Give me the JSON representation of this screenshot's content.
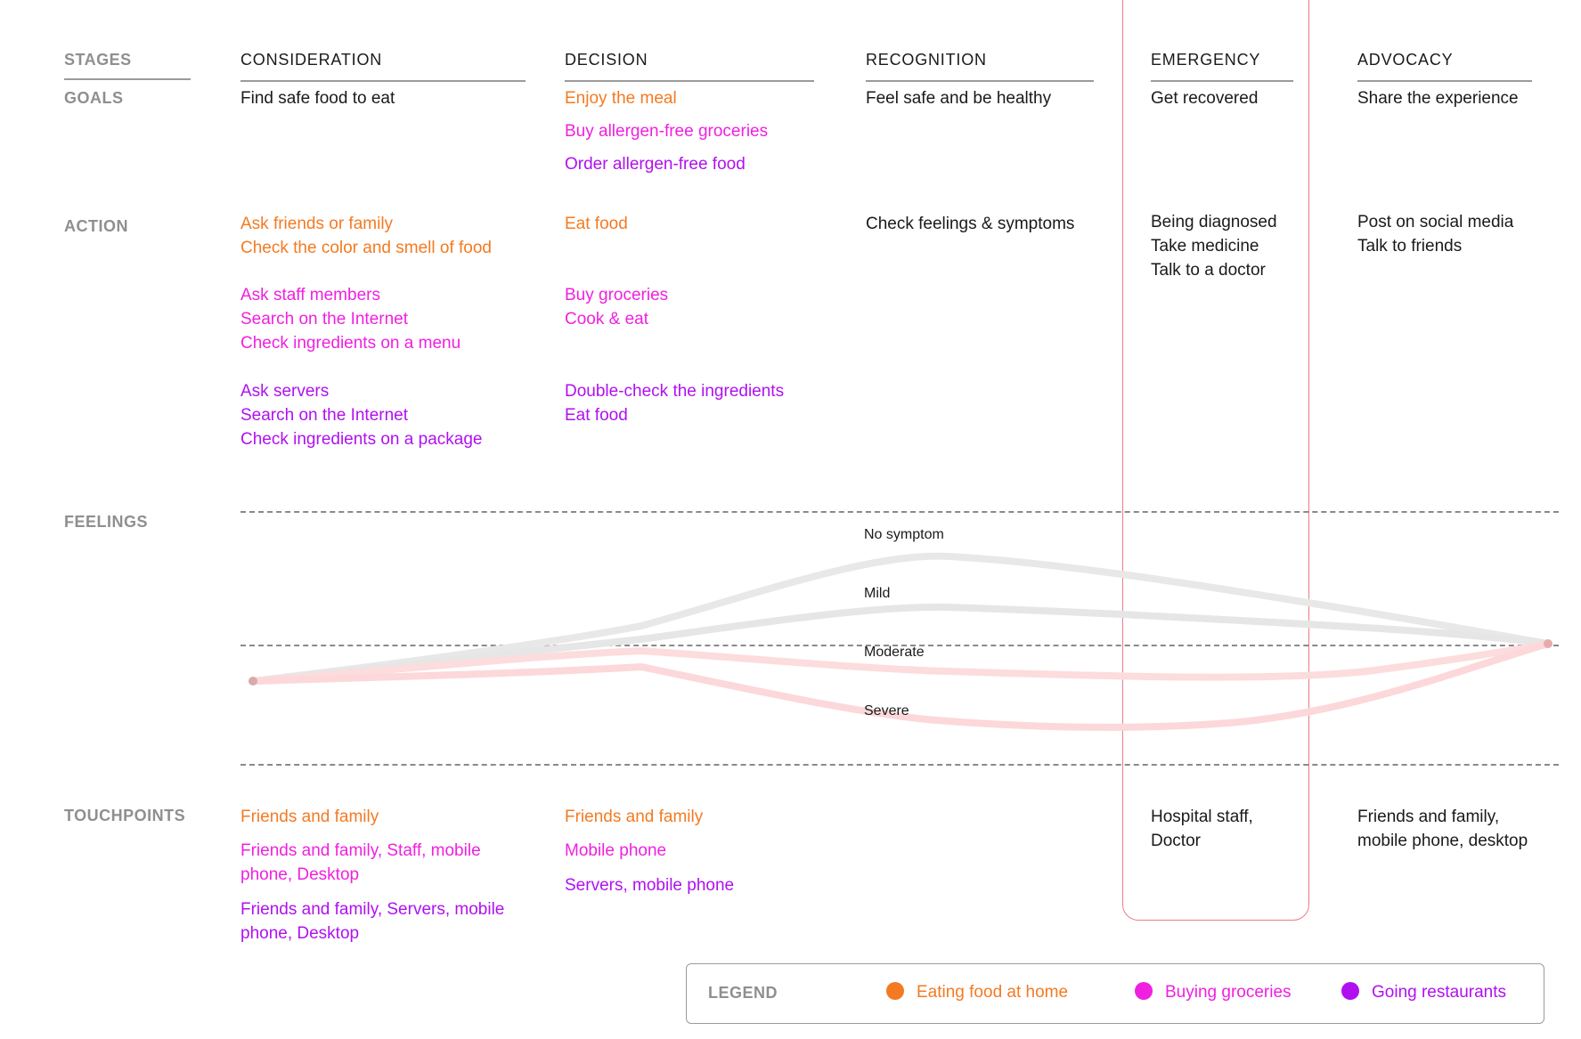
{
  "labels": {
    "stages": "STAGES",
    "goals": "GOALS",
    "action": "ACTION",
    "feelings": "FEELINGS",
    "touchpoints": "TOUCHPOINTS"
  },
  "stages": [
    "CONSIDERATION",
    "DECISION",
    "RECOGNITION",
    "EMERGENCY",
    "ADVOCACY"
  ],
  "goals": {
    "consideration": "Find safe food to eat",
    "decision": [
      "Enjoy the meal",
      "Buy allergen-free groceries",
      "Order allergen-free food"
    ],
    "recognition": "Feel safe and be healthy",
    "emergency": "Get recovered",
    "advocacy": "Share the experience"
  },
  "actions": {
    "consideration": {
      "home": [
        "Ask friends or family",
        "Check the color and smell of food"
      ],
      "groceries": [
        "Ask staff members",
        "Search on the Internet",
        "Check ingredients on a menu"
      ],
      "restaurants": [
        "Ask servers",
        "Search on the Internet",
        "Check ingredients on a package"
      ]
    },
    "decision": {
      "home": [
        "Eat food"
      ],
      "groceries": [
        "Buy groceries",
        "Cook & eat"
      ],
      "restaurants": [
        "Double-check the ingredients",
        "Eat food"
      ]
    },
    "recognition": [
      "Check feelings & symptoms"
    ],
    "emergency": [
      "Being diagnosed",
      "Take medicine",
      "Talk to a doctor"
    ],
    "advocacy": [
      "Post on social media",
      "Talk to friends"
    ]
  },
  "feelings": {
    "levels": [
      "No symptom",
      "Mild",
      "Moderate",
      "Severe"
    ]
  },
  "touchpoints": {
    "consideration": [
      "Friends and family",
      "Friends and family, Staff, mobile phone, Desktop",
      "Friends and family, Servers, mobile phone, Desktop"
    ],
    "decision": [
      "Friends and family",
      "Mobile phone",
      "Servers, mobile phone"
    ],
    "emergency": "Hospital staff, Doctor",
    "advocacy": "Friends and family, mobile phone, desktop"
  },
  "legend": {
    "title": "LEGEND",
    "items": [
      {
        "label": "Eating food at home",
        "color": "#f47a22"
      },
      {
        "label": "Buying groceries",
        "color": "#f020e0"
      },
      {
        "label": "Going restaurants",
        "color": "#b010f0"
      }
    ]
  },
  "colors": {
    "home": "#f47a22",
    "groceries": "#f020e0",
    "restaurants": "#b010f0",
    "emergency_outline": "#f07a88",
    "curve_good": "#e3e3e3",
    "curve_bad": "#fdd5d7"
  }
}
